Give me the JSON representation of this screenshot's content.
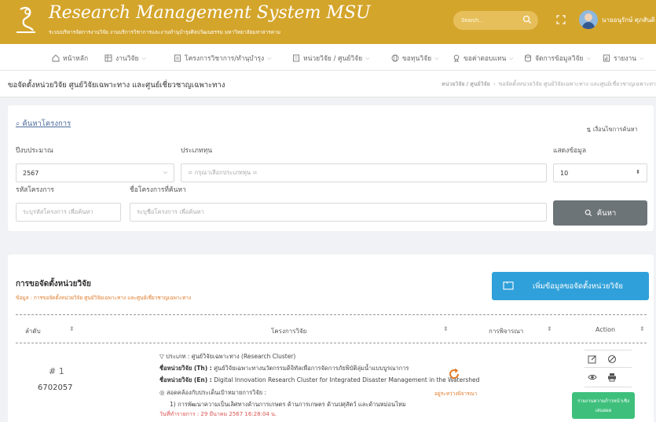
{
  "header": {
    "title": "Research Management System MSU",
    "subtitle": "ระบบบริหารจัดการงานวิจัย งานบริการวิชาการและงานทำนุบำรุงศิลปวัฒนธรรม มหาวิทยาลัยมหาสารคาม",
    "search_placeholder": "Search...",
    "user_name": "นายอนุรักษ์ ศุภสันติ"
  },
  "nav": {
    "items": [
      {
        "label": "หน้าหลัก",
        "icon": "home-icon"
      },
      {
        "label": "งานวิจัย",
        "icon": "table-icon"
      },
      {
        "label": "โครงการวิชาการ/ทำนุบำรุง",
        "icon": "document-icon"
      },
      {
        "label": "หน่วยวิจัย / ศูนย์วิจัย",
        "icon": "building-icon"
      },
      {
        "label": "ขอทุนวิจัย",
        "icon": "globe-icon"
      },
      {
        "label": "ขอค่าตอบแทน",
        "icon": "award-icon"
      },
      {
        "label": "จัดการข้อมูลวิจัย",
        "icon": "database-icon"
      },
      {
        "label": "รายงาน",
        "icon": "report-icon"
      }
    ]
  },
  "page": {
    "title": "ขอจัดตั้งหน่วยวิจัย ศูนย์วิจัยเฉพาะทาง และศูนย์เชี่ยวชาญเฉพาะทาง",
    "breadcrumb_parent": "หน่วยวิจัย / ศูนย์วิจัย",
    "breadcrumb_current": "ขอจัดตั้งหน่วยวิจัย ศูนย์วิจัยเฉพาะทาง และศูนย์เชี่ยวชาญเฉพาะทา"
  },
  "search": {
    "link_label": "ค้นหาโครงการ",
    "advanced_label": "เงื่อนไขการค้นหา",
    "fiscal_year_label": "ปีงบประมาณ",
    "fiscal_year_value": "2567",
    "fund_type_label": "ประเภททุน",
    "fund_type_placeholder": "= กรุณาเลือกประเภททุน =",
    "show_label": "แสดงข้อมูล",
    "show_value": "10",
    "project_code_label": "รหัสโครงการ",
    "project_code_placeholder": "ระบุรหัสโครงการ เพื่อค้นหา",
    "project_name_label": "ชื่อโครงการที่ค้นหา",
    "project_name_placeholder": "ระบุชื่อโครงการ เพื่อค้นหา",
    "search_button": "ค้นหา"
  },
  "list": {
    "title": "การขอจัดตั้งหน่วยวิจัย",
    "subtitle": "ข้อมูล : การขอจัดตั้งหน่วยวิจัย ศูนย์วิจัยเฉพาะทาง และศูนย์เชี่ยวชาญเฉพาะทาง",
    "add_button": "เพิ่มข้อมูลขอจัดตั้งหน่วยวิจัย",
    "columns": [
      "ลำดับ",
      "โครงการวิจัย",
      "การพิจารณา",
      "Action"
    ],
    "rows": [
      {
        "number": "# 1",
        "id": "6702057",
        "type_text": "ประเภท : ศูนย์วิจัยเฉพาะทาง (Research Cluster)",
        "name_th_label": "ชื่อหน่วยวิจัย (Th) :",
        "name_th": "ศูนย์วิจัยเฉพาะทางนวัตกรรมดิจิทัลเพื่อการจัดการภัยพิบัติลุ่มน้ำแบบบูรณาการ",
        "name_en_label": "ชื่อหน่วยวิจัย (En) :",
        "name_en": "Digital Innovation Research Cluster for Integrated Disaster Management in the Watershed",
        "alignment_label": "สอดคล้องกับประเด็นเป้าหมายการวิจัย :",
        "alignment_value": "1) การพัฒนาความเป็นเลิศทางด้านการเกษตร ด้านการเกษตร ด้านปศุสัตว์ และด้านหม่อนไหม",
        "submitted": "วันที่ทำรายการ : 29 มีนาคม 2567 16:28:04 น.",
        "status": "อยู่ระหว่างพิจารณา",
        "report_button_line1": "รายงานความก้าวหน้าเชิง",
        "report_button_line2": "เสนอผล"
      }
    ]
  },
  "colors": {
    "header_bg": "#d4a52b",
    "add_button": "#2fa0d9",
    "search_button": "#6d7478",
    "status_orange": "#e07c2c",
    "report_green": "#3ec07c"
  }
}
